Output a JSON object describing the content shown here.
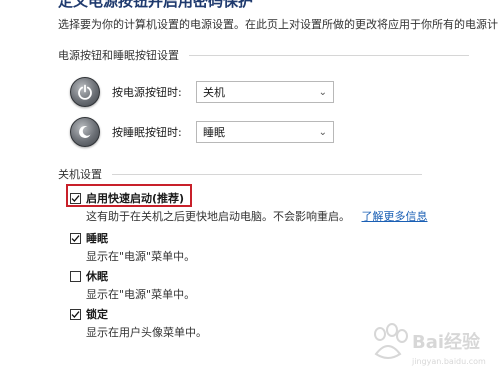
{
  "header": {
    "title": "定义电源按钮并启用密码保护",
    "description": "选择要为你的计算机设置的电源设置。在此页上对设置所做的更改将应用于你所有的电源计"
  },
  "power_section": {
    "title": "电源按钮和睡眠按钮设置",
    "rows": [
      {
        "label": "按电源按钮时:",
        "value": "关机",
        "icon": "power-button-icon"
      },
      {
        "label": "按睡眠按钮时:",
        "value": "睡眠",
        "icon": "sleep-button-icon"
      }
    ]
  },
  "shutdown_section": {
    "title": "关机设置",
    "options": [
      {
        "label": "启用快速启动(推荐)",
        "checked": true,
        "desc": "这有助于在关机之后更快地启动电脑。不会影响重启。",
        "link": "了解更多信息"
      },
      {
        "label": "睡眠",
        "checked": true,
        "desc": "显示在\"电源\"菜单中。"
      },
      {
        "label": "休眠",
        "checked": false,
        "desc": "显示在\"电源\"菜单中。"
      },
      {
        "label": "锁定",
        "checked": true,
        "desc": "显示在用户头像菜单中。"
      }
    ]
  },
  "colors": {
    "highlight": "#c8202a",
    "link": "#1a5fb4",
    "title": "#1f3a6e"
  },
  "watermark": {
    "text": "Baidu 经验"
  }
}
